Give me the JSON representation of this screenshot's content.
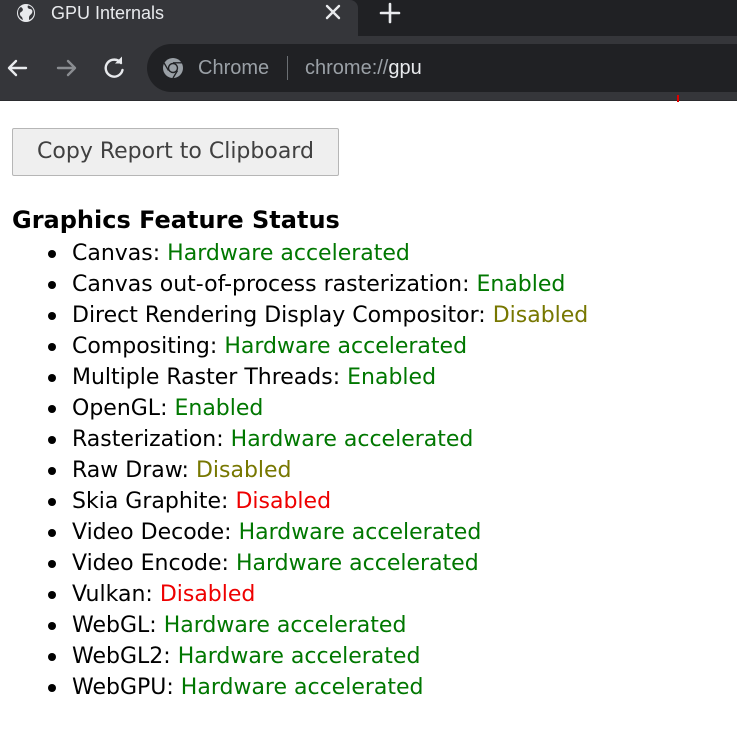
{
  "browser": {
    "tab": {
      "title": "GPU Internals",
      "favicon": "globe-icon"
    },
    "omnibox": {
      "origin_label": "Chrome",
      "url_scheme": "chrome://",
      "url_host": "gpu"
    }
  },
  "page": {
    "copy_button_label": "Copy Report to Clipboard",
    "section_title": "Graphics Feature Status",
    "features": [
      {
        "name": "Canvas:",
        "status": "Hardware accelerated"
      },
      {
        "name": "Canvas out-of-process rasterization:",
        "status": "Enabled"
      },
      {
        "name": "Direct Rendering Display Compositor:",
        "status": "Disabled"
      },
      {
        "name": "Compositing:",
        "status": "Hardware accelerated"
      },
      {
        "name": "Multiple Raster Threads:",
        "status": "Enabled"
      },
      {
        "name": "OpenGL:",
        "status": "Enabled"
      },
      {
        "name": "Rasterization:",
        "status": "Hardware accelerated"
      },
      {
        "name": "Raw Draw:",
        "status": "Disabled"
      },
      {
        "name": "Skia Graphite:",
        "status": "Disabled"
      },
      {
        "name": "Video Decode:",
        "status": "Hardware accelerated"
      },
      {
        "name": "Video Encode:",
        "status": "Hardware accelerated"
      },
      {
        "name": "Vulkan:",
        "status": "Disabled"
      },
      {
        "name": "WebGL:",
        "status": "Hardware accelerated"
      },
      {
        "name": "WebGL2:",
        "status": "Hardware accelerated"
      },
      {
        "name": "WebGPU:",
        "status": "Hardware accelerated"
      }
    ]
  },
  "colors": {
    "status_green": "#007700",
    "status_olive": "#777700",
    "status_red": "#ee0000"
  }
}
